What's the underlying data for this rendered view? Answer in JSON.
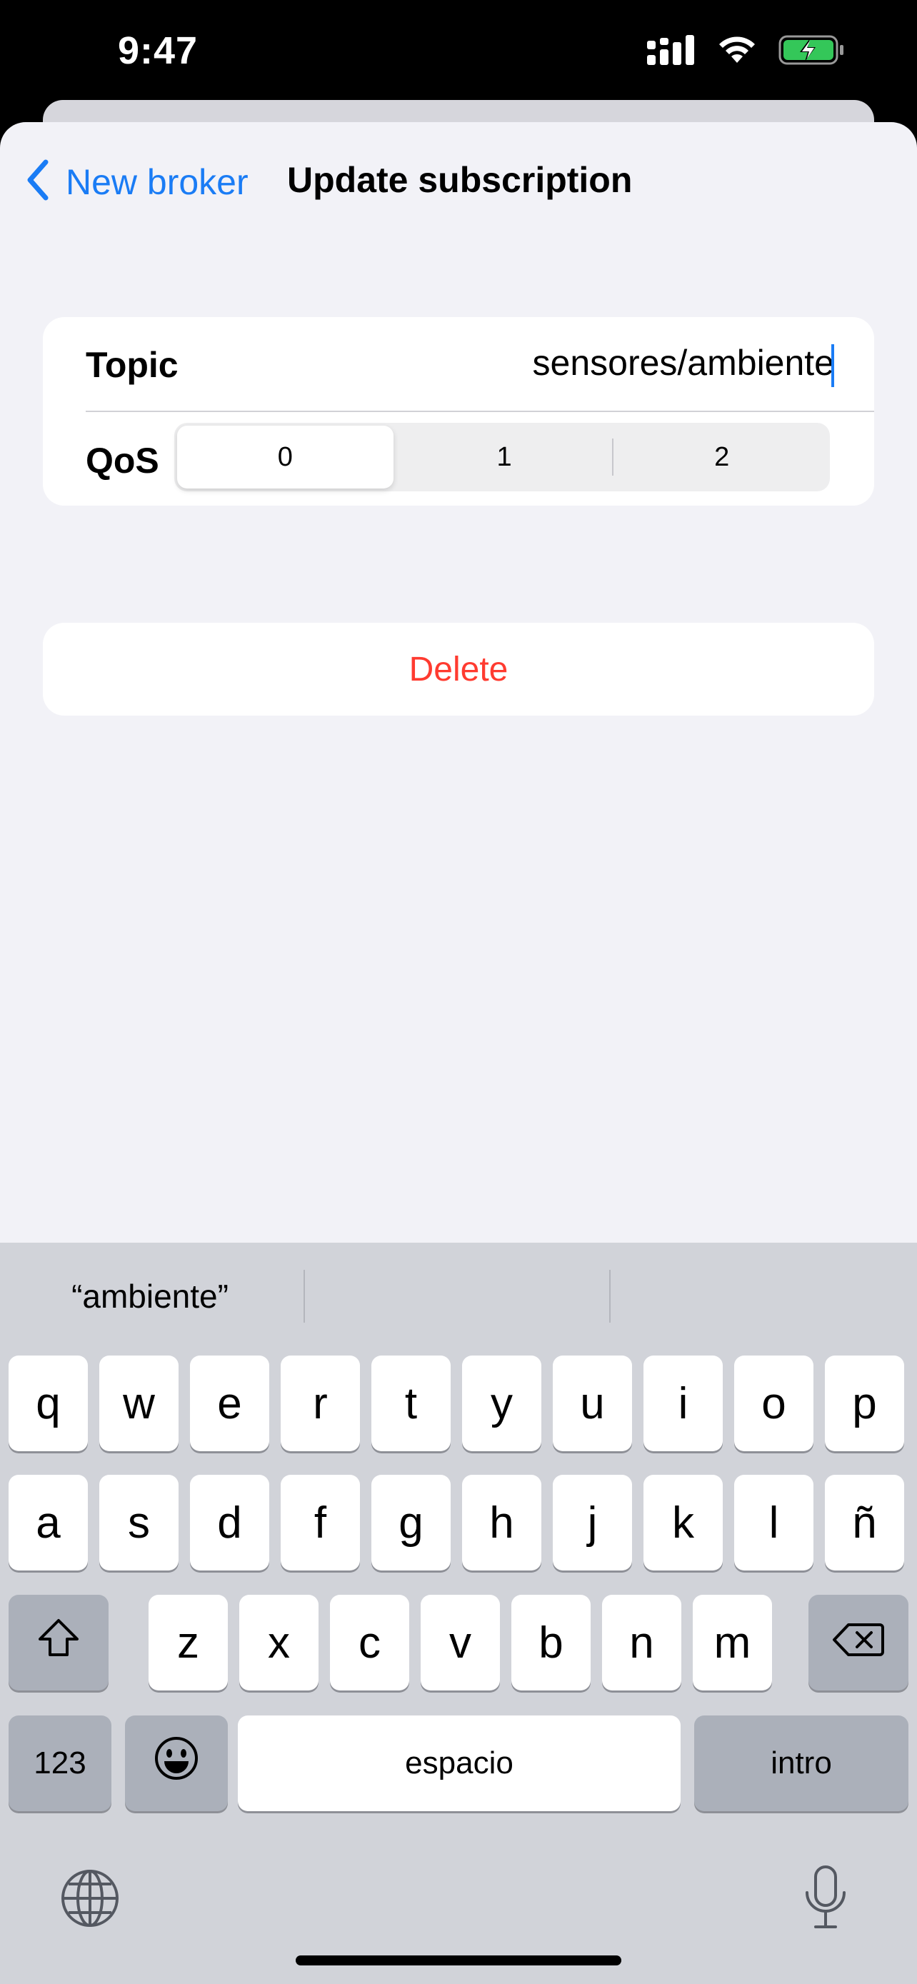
{
  "status_bar": {
    "time": "9:47",
    "icons": [
      "cellular-signal-icon",
      "wifi-icon",
      "battery-charging-icon"
    ],
    "battery_color": "#34c759"
  },
  "nav": {
    "back_label": "New broker",
    "title": "Update subscription",
    "accent": "#1a7cf5"
  },
  "form": {
    "topic_label": "Topic",
    "topic_value": "sensores/ambiente",
    "qos_label": "QoS",
    "qos_options": [
      "0",
      "1",
      "2"
    ],
    "qos_selected": "0"
  },
  "delete": {
    "label": "Delete",
    "color": "#ff3b30"
  },
  "keyboard": {
    "predictions": [
      "“ambiente”",
      "",
      ""
    ],
    "row1": [
      "q",
      "w",
      "e",
      "r",
      "t",
      "y",
      "u",
      "i",
      "o",
      "p"
    ],
    "row2": [
      "a",
      "s",
      "d",
      "f",
      "g",
      "h",
      "j",
      "k",
      "l",
      "ñ"
    ],
    "row3": [
      "z",
      "x",
      "c",
      "v",
      "b",
      "n",
      "m"
    ],
    "numbers_label": "123",
    "space_label": "espacio",
    "return_label": "intro",
    "icons": [
      "shift-icon",
      "backspace-icon",
      "emoji-icon",
      "globe-icon",
      "microphone-icon"
    ]
  }
}
